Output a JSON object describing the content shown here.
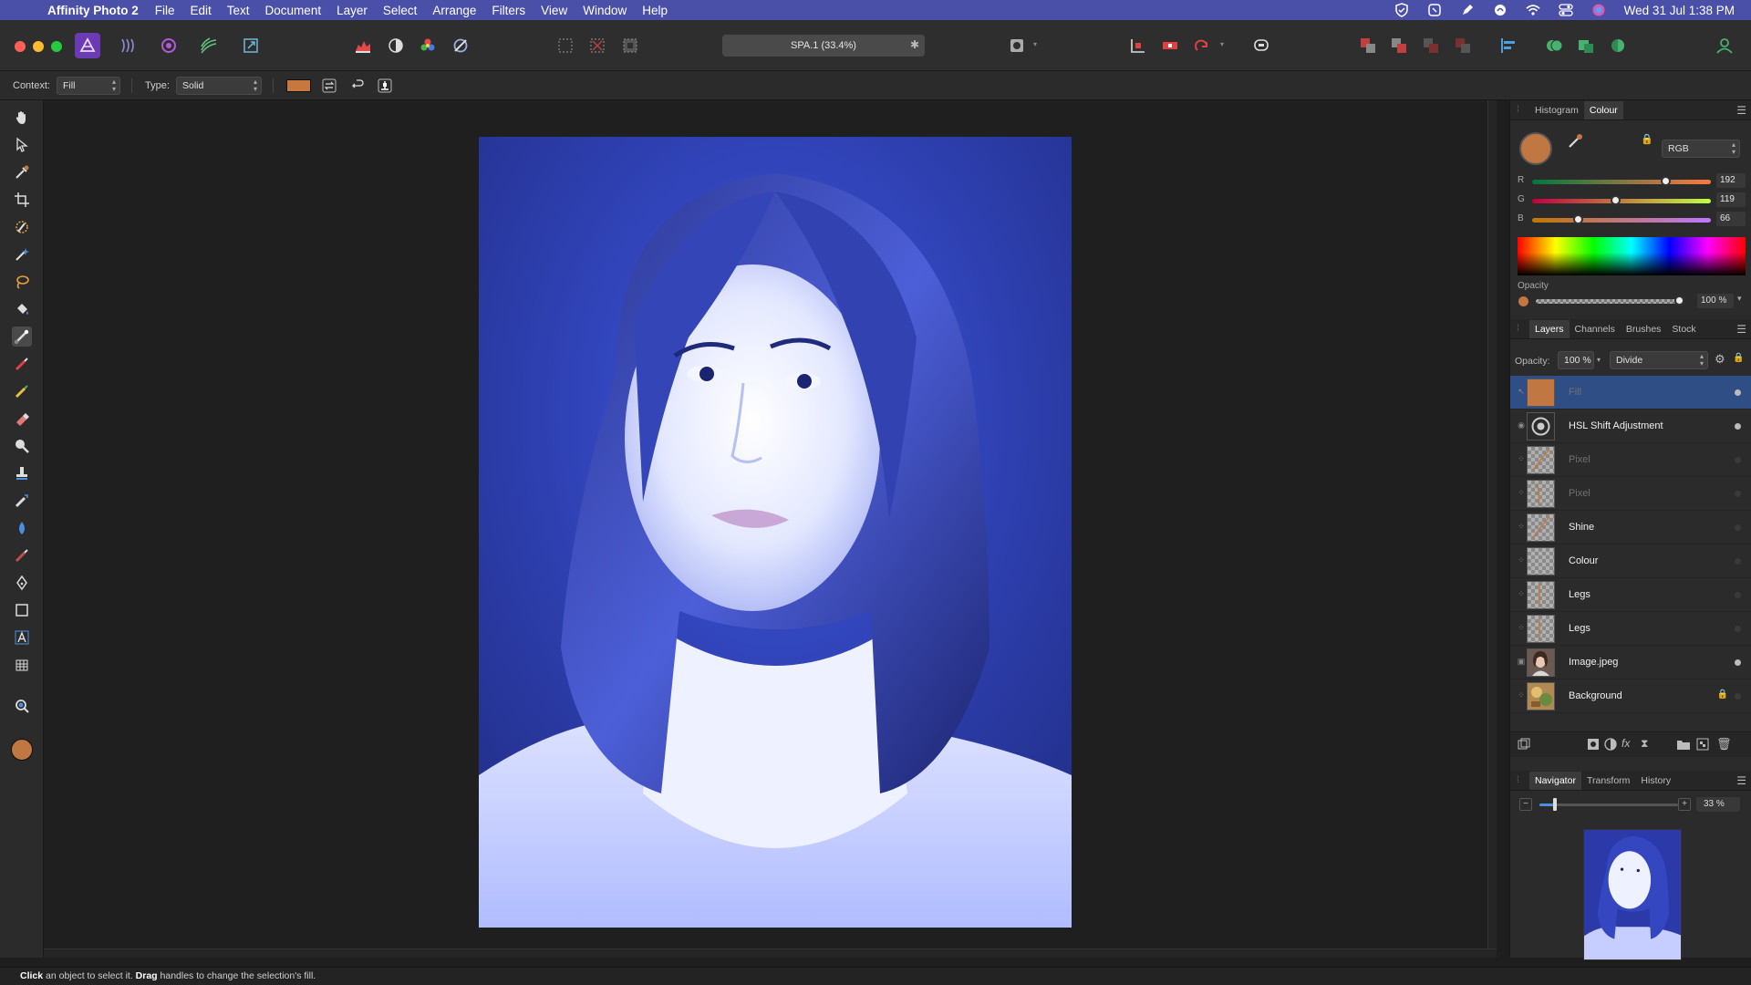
{
  "menubar": {
    "app_name": "Affinity Photo 2",
    "items": [
      "File",
      "Edit",
      "Text",
      "Document",
      "Layer",
      "Select",
      "Arrange",
      "Filters",
      "View",
      "Window",
      "Help"
    ],
    "clock": "Wed 31 Jul  1:38 PM"
  },
  "document": {
    "tab_title": "SPA.1 (33.4%)",
    "close_glyph": "✱"
  },
  "context_toolbar": {
    "context_label": "Context:",
    "context_value": "Fill",
    "type_label": "Type:",
    "type_value": "Solid",
    "swatch_color": "#c77841"
  },
  "colour_panel": {
    "tabs": [
      "Histogram",
      "Colour"
    ],
    "active_tab": "Colour",
    "model": "RGB",
    "current_color": "#c07742",
    "channels": [
      {
        "label": "R",
        "value": "192",
        "fraction": 0.75
      },
      {
        "label": "G",
        "value": "119",
        "fraction": 0.47
      },
      {
        "label": "B",
        "value": "66",
        "fraction": 0.26
      }
    ],
    "opacity_label": "Opacity",
    "opacity_value": "100 %"
  },
  "layers_panel": {
    "tabs": [
      "Layers",
      "Channels",
      "Brushes",
      "Stock"
    ],
    "active_tab": "Layers",
    "opacity_label": "Opacity:",
    "opacity_value": "100 %",
    "blend_mode": "Divide",
    "layers": [
      {
        "name": "Fill",
        "dim": true,
        "dot": "visible",
        "thumb": "fill",
        "selected": true
      },
      {
        "name": "HSL Shift Adjustment",
        "dim": false,
        "dot": "visible",
        "thumb": "adjust",
        "selected": false
      },
      {
        "name": "Pixel",
        "dim": true,
        "dot": "dim",
        "thumb": "pixel",
        "selected": false
      },
      {
        "name": "Pixel",
        "dim": true,
        "dot": "dim",
        "thumb": "pixel2",
        "selected": false
      },
      {
        "name": "Shine",
        "dim": false,
        "dot": "dim",
        "thumb": "pixel",
        "selected": false
      },
      {
        "name": "Colour",
        "dim": false,
        "dot": "dim",
        "thumb": "empty",
        "selected": false
      },
      {
        "name": "Legs",
        "dim": false,
        "dot": "dim",
        "thumb": "legs",
        "selected": false
      },
      {
        "name": "Legs",
        "dim": false,
        "dot": "dim",
        "thumb": "legs",
        "selected": false
      },
      {
        "name": "Image.jpeg",
        "dim": false,
        "dot": "visible",
        "thumb": "photo",
        "selected": false
      },
      {
        "name": "Background",
        "dim": false,
        "dot": "dim",
        "thumb": "bg",
        "selected": false,
        "locked": true
      }
    ]
  },
  "navigator_panel": {
    "tabs": [
      "Navigator",
      "Transform",
      "History"
    ],
    "active_tab": "Navigator",
    "zoom": "33 %",
    "zoom_fraction": 0.11
  },
  "statusbar": {
    "click": "Click",
    "text1": " an object to select it. ",
    "drag": "Drag",
    "text2": " handles to change the selection's fill."
  }
}
